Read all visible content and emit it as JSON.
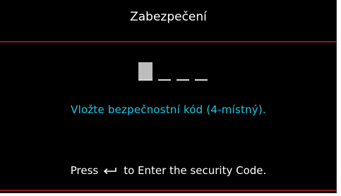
{
  "dialog": {
    "title": "Zabezpečení",
    "code": {
      "digits": 4,
      "entered": 0,
      "active_index": 0
    },
    "prompt": "Vložte bezpečnostní kód (4-místný).",
    "hint_before": "Press",
    "hint_icon": "enter-icon",
    "hint_after": "to Enter the security Code."
  },
  "colors": {
    "background": "#000000",
    "divider": "#8b1a1a",
    "title_text": "#ffffff",
    "prompt_text": "#1ec8e6",
    "hint_text": "#ffffff"
  }
}
